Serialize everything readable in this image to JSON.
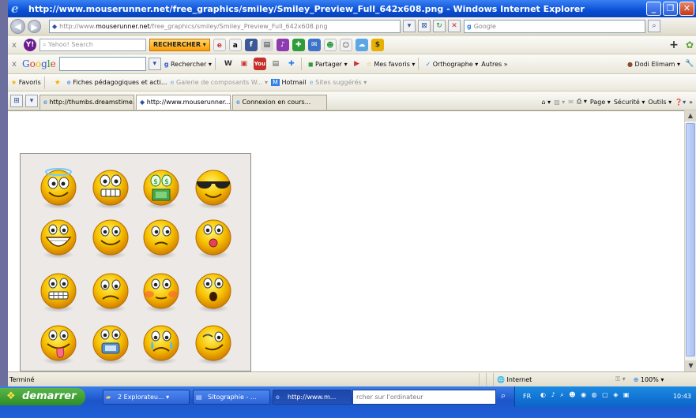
{
  "window": {
    "title": "http://www.mouserunner.net/free_graphics/smiley/Smiley_Preview_Full_642x608.png - Windows Internet Explorer"
  },
  "address": {
    "url_prefix": "http://www.",
    "url_domain": "mouserunner.net",
    "url_path": "/free_graphics/smiley/Smiley_Preview_Full_642x608.png",
    "search_engine": "Google"
  },
  "yahoo_bar": {
    "search_placeholder": "Yahoo! Search",
    "search_button": "RECHERCHER"
  },
  "google_bar": {
    "logo": "Google",
    "search_button": "Rechercher",
    "share": "Partager",
    "favorites": "Mes favoris",
    "spelling": "Orthographe",
    "others": "Autres »",
    "user": "Dodi Elimam"
  },
  "favorites_bar": {
    "label": "Favoris",
    "items": [
      "Fiches pédagogiques et acti...",
      "Galerie de composants W...",
      "Hotmail",
      "Sites suggérés"
    ]
  },
  "tabs": {
    "items": [
      "http://thumbs.dreamstime.c...",
      "http://www.mouserunner....",
      "Connexion en cours..."
    ]
  },
  "command_bar": {
    "page": "Page",
    "security": "Sécurité",
    "tools": "Outils"
  },
  "status_bar": {
    "status": "Terminé",
    "zone": "Internet",
    "zoom": "100%"
  },
  "taskbar": {
    "start": "demarrer",
    "tasks": [
      "2 Explorateu...",
      "Sitographie - ...",
      "http://www.m..."
    ],
    "search_placeholder": "rcher sur l'ordinateur",
    "lang": "FR",
    "clock": "10:43"
  },
  "colors": {
    "titlebar": "#0a4fd6",
    "taskbar": "#245edb",
    "start": "#3c9b32",
    "smiley_yellow": "#f7c300"
  }
}
